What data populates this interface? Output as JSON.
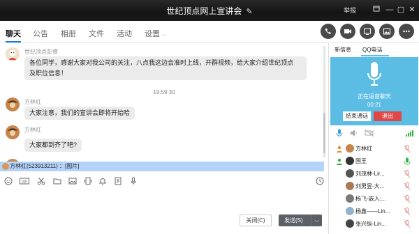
{
  "window": {
    "title": "世纪顶点网上宣讲会",
    "report_label": "举报",
    "colors": {
      "titlebar": "#1b1b1b",
      "accent": "#1a7cd8",
      "voice_panel": "#5bbce4",
      "exit_red": "#e04848"
    }
  },
  "tabs": [
    {
      "label": "聊天",
      "active": true
    },
    {
      "label": "公告"
    },
    {
      "label": "相册"
    },
    {
      "label": "文件"
    },
    {
      "label": "活动"
    },
    {
      "label": "设置"
    }
  ],
  "tab_icons": [
    "phone-icon",
    "video-icon",
    "share-screen-icon",
    "image-icon",
    "add-icon",
    "more-icon"
  ],
  "messages": [
    {
      "sender": "世纪顶点彭睿",
      "lines": [
        "各位同学，感谢大家对我公司的关注，八点我这边会准时上线，开群视频，给大家介绍世纪顶点",
        "及职位信息！"
      ]
    },
    {
      "timestamp": "19:59:30"
    },
    {
      "sender": "方林红",
      "text": "大家注意，我们的宣讲会即将开始哈"
    },
    {
      "sender": "方林红",
      "text": "大家都到齐了吧?"
    }
  ],
  "quote_bar": {
    "text": "方林红(523913211) ：[图片]"
  },
  "toolbar_icons": [
    "emoji-icon",
    "gif-icon",
    "scissors-icon",
    "folder-icon",
    "image-icon",
    "shake-icon",
    "bell-icon",
    "note-icon",
    "mic-icon",
    "history-icon"
  ],
  "buttons": {
    "close": "关闭(C)",
    "send": "发送(S)"
  },
  "right_panel": {
    "tabs": [
      "新信息",
      "QQ电话"
    ],
    "voice": {
      "status": "正在语音聊天",
      "duration": "00:21",
      "end_label": "结束通话",
      "exit_label": "退出"
    },
    "members": [
      {
        "name": "方林红",
        "mic": "muted"
      },
      {
        "name": "国王",
        "mic": "active"
      },
      {
        "name": "刘茂林-Lir...",
        "mic": "muted"
      },
      {
        "name": "刘男昱-大...",
        "mic": "muted"
      },
      {
        "name": "杨飞-嵌入:...",
        "mic": "muted"
      },
      {
        "name": "杨鑫——Lin...",
        "mic": "muted"
      },
      {
        "name": "张兴纵-Lin...",
        "mic": "muted"
      }
    ]
  }
}
